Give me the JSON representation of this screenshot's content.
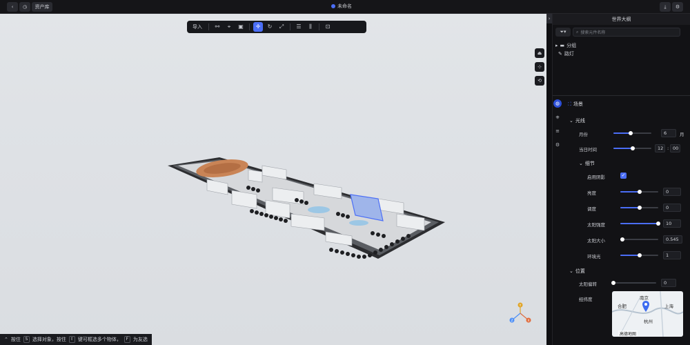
{
  "topbar": {
    "back_icon": "chevron-left-icon",
    "history_icon": "clock-icon",
    "asset_library_label": "资产库",
    "document_title": "未命名",
    "download_icon": "download-icon",
    "settings_icon": "settings-icon"
  },
  "toolbar": {
    "import_label": "导入"
  },
  "statusbar": {
    "hold_label": "按住",
    "hold_key": "S",
    "select_objects_label": "选择对象，按住",
    "multi_key": "⇧",
    "multi_label": "键可框选多个物体，",
    "focus_key": "F",
    "focus_label": "为友选"
  },
  "outline": {
    "title": "世界大纲",
    "search_placeholder": "搜索元件名称",
    "items": [
      {
        "label": "分组",
        "icon": "folder-icon"
      },
      {
        "label": "路灯",
        "icon": "lamp-icon"
      }
    ]
  },
  "scene": {
    "title": "场景",
    "lighting_label": "光线",
    "month_label": "月份",
    "month_value": "6",
    "month_unit": "月",
    "month_fraction": 0.45,
    "time_label": "当日时间",
    "time_hour": "12",
    "time_sep": ":",
    "time_minute": "00",
    "time_fraction": 0.5,
    "detail_label": "细节",
    "shadow_label": "启用阴影",
    "shadow_enabled": true,
    "shadow_check": "✓",
    "brightness_label": "亮度",
    "brightness_value": "0",
    "brightness_fraction": 0.5,
    "contrast_label": "调度",
    "contrast_value": "0",
    "contrast_fraction": 0.5,
    "sun_intensity_label": "太阳强度",
    "sun_intensity_value": "10",
    "sun_intensity_fraction": 1.0,
    "sun_size_label": "太阳大小",
    "sun_size_value": "0.545",
    "sun_size_fraction": 0.06,
    "ambient_label": "环境光",
    "ambient_value": "1",
    "ambient_fraction": 0.5,
    "position_label": "位置",
    "sun_rotation_label": "太阳偏转",
    "sun_rotation_value": "0",
    "sun_rotation_fraction": 0.0,
    "latlng_label": "经纬度"
  },
  "map": {
    "cities": [
      "南京",
      "合肥",
      "上海",
      "杭州"
    ],
    "legal": "高德地图"
  },
  "axis": {
    "x": "X",
    "y": "Y",
    "z": "Z"
  },
  "colors": {
    "accent": "#4b6ef6",
    "panel_bg": "#121215",
    "viewport_bg": "#dfe2e6"
  }
}
